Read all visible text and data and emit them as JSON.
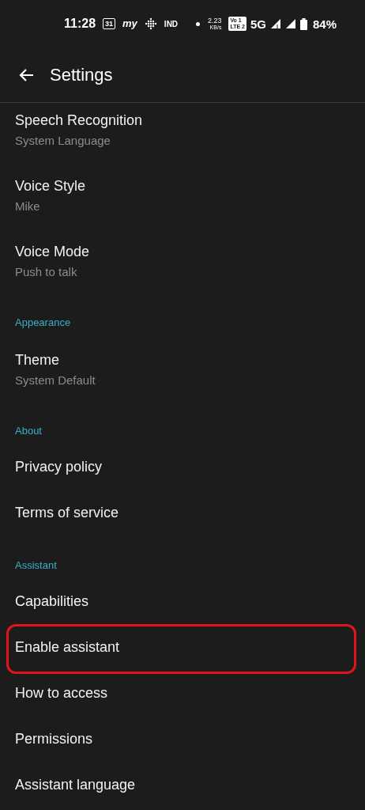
{
  "status_bar": {
    "time": "11:28",
    "icons": [
      {
        "kind": "calendar",
        "text": "31"
      },
      {
        "kind": "logo",
        "text": "my"
      },
      {
        "kind": "grid"
      },
      {
        "kind": "ind",
        "text": "IND"
      },
      {
        "kind": "dot"
      }
    ],
    "speed": {
      "value": "2.23",
      "unit": "KB/s"
    },
    "volte": {
      "top": "Vo 1",
      "bottom": "LTE 2"
    },
    "network": "5G",
    "battery": "84%"
  },
  "app_bar": {
    "title": "Settings"
  },
  "sections": [
    {
      "items": [
        {
          "title": "Speech Recognition",
          "subtitle": "System Language"
        },
        {
          "title": "Voice Style",
          "subtitle": "Mike"
        },
        {
          "title": "Voice Mode",
          "subtitle": "Push to talk"
        }
      ]
    },
    {
      "header": "Appearance",
      "items": [
        {
          "title": "Theme",
          "subtitle": "System Default"
        }
      ]
    },
    {
      "header": "About",
      "items": [
        {
          "title": "Privacy policy"
        },
        {
          "title": "Terms of service"
        }
      ]
    },
    {
      "header": "Assistant",
      "items": [
        {
          "title": "Capabilities"
        },
        {
          "title": "Enable assistant",
          "highlighted": true
        },
        {
          "title": "How to access"
        },
        {
          "title": "Permissions"
        },
        {
          "title": "Assistant language"
        }
      ]
    }
  ]
}
